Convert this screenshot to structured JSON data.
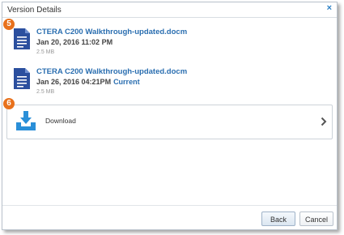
{
  "dialog": {
    "title": "Version Details",
    "close_glyph": "×"
  },
  "callouts": [
    "5",
    "6"
  ],
  "versions": [
    {
      "icon": "document-icon",
      "filename": "CTERA C200 Walkthrough-updated.docm",
      "date": "Jan 20, 2016 11:02 PM",
      "status": "",
      "size": "2.5 MB"
    },
    {
      "icon": "document-icon",
      "filename": "CTERA C200 Walkthrough-updated.docm",
      "date": "Jan 26, 2016 04:21PM",
      "status": "Current",
      "size": "2.5 MB"
    }
  ],
  "download": {
    "icon": "download-icon",
    "label": "Download",
    "chevron": "chevron-right-icon"
  },
  "footer": {
    "back_label": "Back",
    "cancel_label": "Cancel"
  },
  "colors": {
    "accent": "#2a6eb0",
    "badge": "#e8711c",
    "doc_icon": "#2b4f9e",
    "download_icon": "#2a8fd8"
  }
}
